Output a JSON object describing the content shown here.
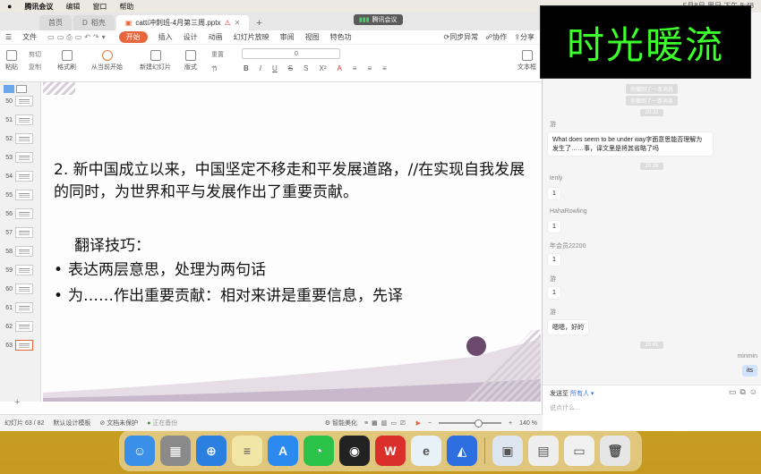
{
  "menubar": {
    "apple": "",
    "app": "腾讯会议",
    "edit": "编辑",
    "window": "窗口",
    "help": "帮助",
    "clock": "5月8日 周日 下午 8:48"
  },
  "wps": {
    "tabs": [
      {
        "label": "首页"
      },
      {
        "label": "稻壳"
      },
      {
        "label": "catti冲刺班-4月第三周.pptx"
      }
    ],
    "meeting_pill": "腾讯会议",
    "menu": {
      "file": "文件",
      "start": "开始",
      "insert": "插入",
      "design": "设计",
      "animation": "动画",
      "slideshow": "幻灯片放映",
      "review": "审阅",
      "view": "视图",
      "special": "特色功",
      "sync": "同步异常",
      "collab": "协作",
      "share": "分享"
    },
    "ribbon": {
      "paste": "粘贴",
      "cut": "剪切",
      "copy": "复制",
      "format_painter": "格式刷",
      "from_current": "从当前开始",
      "new_slide": "新建幻灯片",
      "layout": "版式",
      "section": "节",
      "reset": "重置",
      "font_size": "0",
      "textbox": "文本框"
    },
    "slide_numbers": [
      "50",
      "51",
      "52",
      "53",
      "54",
      "55",
      "56",
      "57",
      "58",
      "59",
      "60",
      "61",
      "62",
      "63"
    ],
    "slide": {
      "title": "2. 新中国成立以来，中国坚定不移走和平发展道路，//在实现自我发展的同时，为世界和平与发展作出了重要贡献。",
      "sub": "翻译技巧：",
      "bullets": [
        "表达两层意思，处理为两句话",
        "为……作出重要贡献：相对来讲是重要信息，先译"
      ]
    },
    "status": {
      "slide_index": "幻灯片 63 / 82",
      "template": "默认设计模板",
      "doc_unprotected": "文档未保护",
      "backup": "正在备份",
      "beautify": "智能美化",
      "zoom": "140 %"
    }
  },
  "banner": "时光暖流",
  "chat": {
    "sys1": "你撤回了一条消息",
    "sys2": "你撤回了一条消息",
    "t1": "20:32",
    "msgs": [
      {
        "name": "游",
        "text": "What does seem to be under way字面意思能否理解为发生了……事，译文里是将其省略了吗"
      },
      {
        "name": "lenly",
        "text": "1"
      },
      {
        "name": "HahaRowling",
        "text": "1"
      },
      {
        "name": "年会员22200",
        "text": "1"
      },
      {
        "name": "游",
        "text": "1"
      },
      {
        "name": "游",
        "text": "嗯嗯，好的"
      }
    ],
    "t2": "20:36",
    "t3": "20:41",
    "mine_name": "minmin",
    "mine_text": "its",
    "send_to": "发送至",
    "send_all": "所有人",
    "placeholder": "说点什么…"
  },
  "dock": [
    {
      "name": "finder",
      "glyph": "☺",
      "color": "#3a8fe8"
    },
    {
      "name": "launchpad",
      "glyph": "▦",
      "color": "#8a8a8a"
    },
    {
      "name": "safari",
      "glyph": "⊕",
      "color": "#2a7fe0"
    },
    {
      "name": "notes",
      "glyph": "≡",
      "color": "#f2e6a6"
    },
    {
      "name": "app-store",
      "glyph": "A",
      "color": "#2a8af0"
    },
    {
      "name": "wechat",
      "glyph": "◔",
      "color": "#2bc24a"
    },
    {
      "name": "qq",
      "glyph": "◉",
      "color": "#222222"
    },
    {
      "name": "wps",
      "glyph": "W",
      "color": "#d9302c"
    },
    {
      "name": "eudic",
      "glyph": "e",
      "color": "#e8f0f8"
    },
    {
      "name": "tencent-meeting",
      "glyph": "◭",
      "color": "#2d6fe0"
    },
    {
      "name": "preview",
      "glyph": "▣",
      "color": "#dde5ee"
    },
    {
      "name": "doc-stack",
      "glyph": "▤",
      "color": "#eeeeee"
    },
    {
      "name": "screenshot",
      "glyph": "▭",
      "color": "#f0f0f0"
    },
    {
      "name": "trash",
      "glyph": "🗑",
      "color": "#e6e6e6"
    }
  ]
}
